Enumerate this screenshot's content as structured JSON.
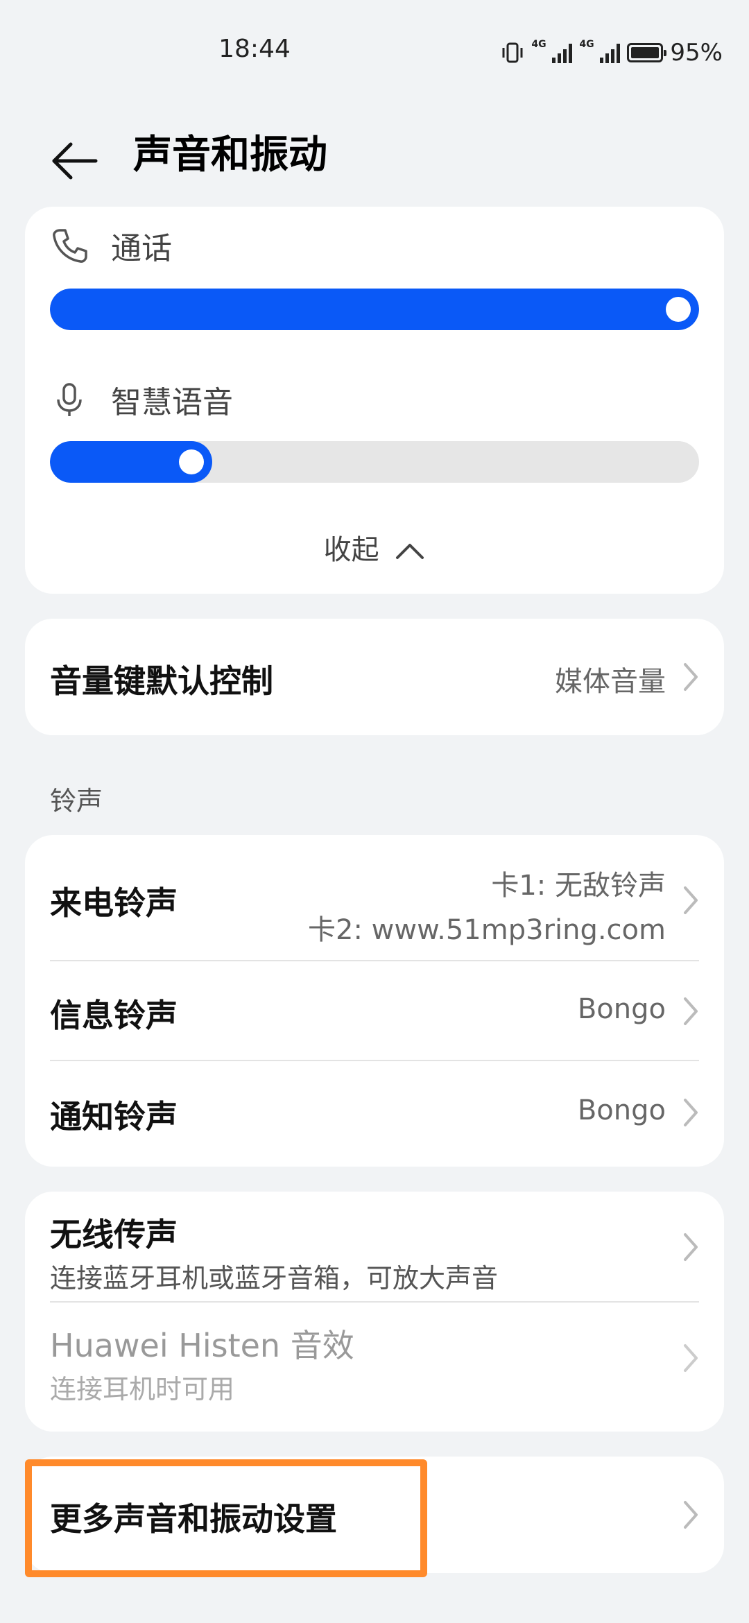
{
  "status_bar": {
    "time": "18:44",
    "signal_labels": [
      "4G",
      "4G"
    ],
    "battery_percent": "95%"
  },
  "header": {
    "back_icon": "arrow-left-icon",
    "title": "声音和振动"
  },
  "volume_card": {
    "call_label": "通话",
    "call_icon": "phone-icon",
    "call_level_percent": 100,
    "voice_label": "智慧语音",
    "voice_icon": "microphone-icon",
    "voice_level_percent": 25,
    "collapse_label": "收起",
    "accent_color": "#0a59f7"
  },
  "volume_key": {
    "label": "音量键默认控制",
    "value": "媒体音量"
  },
  "ringtone_section": {
    "label": "铃声",
    "items": [
      {
        "label": "来电铃声",
        "value_line1": "卡1: 无敌铃声",
        "value_line2": "卡2: www.51mp3ring.com"
      },
      {
        "label": "信息铃声",
        "value": "Bongo"
      },
      {
        "label": "通知铃声",
        "value": "Bongo"
      }
    ]
  },
  "audio_card": {
    "wireless_title": "无线传声",
    "wireless_sub": "连接蓝牙耳机或蓝牙音箱，可放大声音",
    "histen_title": "Huawei Histen 音效",
    "histen_sub": "连接耳机时可用"
  },
  "more": {
    "label": "更多声音和振动设置",
    "highlight_color": "#ff8a2b"
  }
}
